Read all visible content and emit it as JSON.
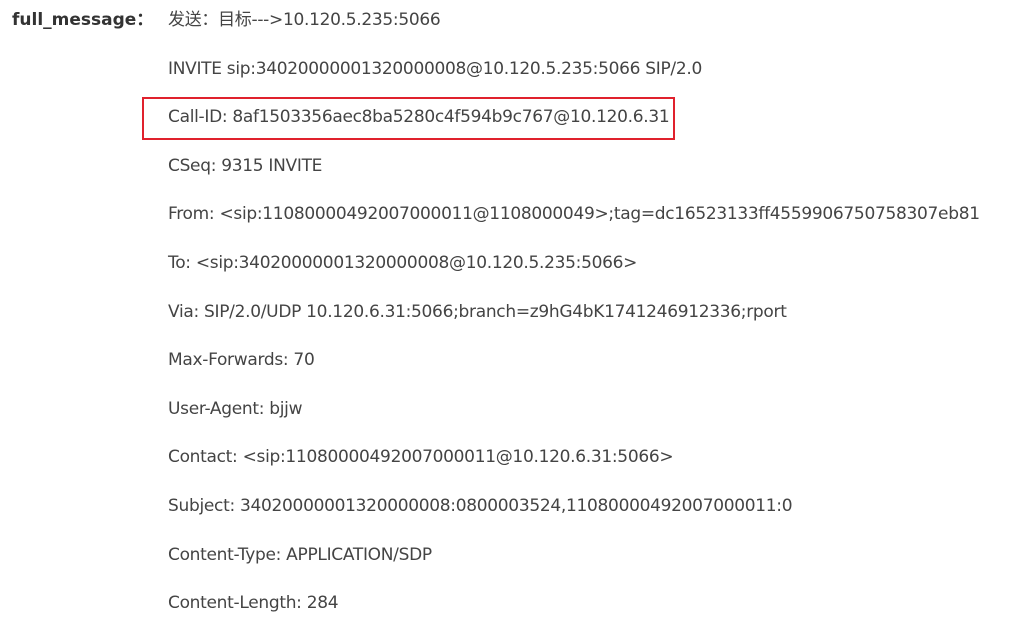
{
  "field": {
    "label": "full_message："
  },
  "message": {
    "lines": [
      "发送：目标--->10.120.5.235:5066",
      "INVITE sip:34020000001320000008@10.120.5.235:5066 SIP/2.0",
      "Call-ID: 8af1503356aec8ba5280c4f594b9c767@10.120.6.31",
      "CSeq: 9315 INVITE",
      "From: <sip:11080000492007000011@1108000049>;tag=dc16523133ff4559906750758307eb81",
      "To: <sip:34020000001320000008@10.120.5.235:5066>",
      "Via: SIP/2.0/UDP 10.120.6.31:5066;branch=z9hG4bK1741246912336;rport",
      "Max-Forwards: 70",
      "User-Agent: bjjw",
      "Contact: <sip:11080000492007000011@10.120.6.31:5066>",
      "Subject: 34020000001320000008:0800003524,11080000492007000011:0",
      "Content-Type: APPLICATION/SDP",
      "Content-Length: 284"
    ]
  },
  "highlight": {
    "color": "#e0212d",
    "target_line": "Call-ID"
  }
}
